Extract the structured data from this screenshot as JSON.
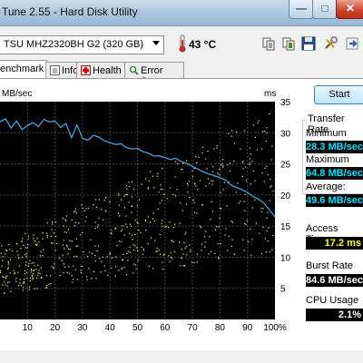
{
  "window": {
    "title": "Tune 2.55 - Hard Disk Utility"
  },
  "toolbar": {
    "drive": "TSU MHZ2320BH G2 (320 GB)",
    "temperature": "43 °C",
    "icons": [
      "copy-icon",
      "copy-all-icon",
      "save-icon",
      "options-icon",
      "exit-icon"
    ]
  },
  "tabs": [
    {
      "label": "enchmark",
      "active": true
    },
    {
      "label": "Info"
    },
    {
      "label": "Health"
    },
    {
      "label": "Error Scan"
    }
  ],
  "start_label": "Start",
  "stats": {
    "transfer_rate_title": "Transfer Rate",
    "minimum_label": "Minimum",
    "minimum_value": "28.3 MB/sec",
    "maximum_label": "Maximum",
    "maximum_value": "64.8 MB/sec",
    "average_label": "Average:",
    "average_value": "49.6 MB/sec",
    "access_time_label": "Access Time:",
    "access_time_value": "17.2 ms",
    "burst_rate_label": "Burst Rate",
    "burst_rate_value": "84.6 MB/sec",
    "cpu_usage_label": "CPU Usage",
    "cpu_usage_value": "2.1%"
  },
  "chart_data": {
    "type": "line",
    "xlabel": "",
    "ylabel_left": "MB/sec",
    "ylabel_right": "ms",
    "x_ticks": [
      "10",
      "20",
      "30",
      "40",
      "50",
      "60",
      "70",
      "80",
      "90",
      "100%"
    ],
    "y_right_ticks": [
      "35",
      "30",
      "25",
      "20",
      "15",
      "10",
      "5"
    ],
    "x_range": [
      0,
      100
    ],
    "y_right_range": [
      0,
      35
    ],
    "grid": true,
    "series": [
      {
        "color": "#4aa0d8",
        "x": [
          0,
          2,
          4,
          6,
          8,
          10,
          12,
          14,
          16,
          18,
          20,
          22,
          24,
          26,
          28,
          30,
          32,
          34,
          36,
          38,
          40,
          42,
          44,
          46,
          48,
          50,
          52,
          54,
          56,
          58,
          60,
          62,
          64,
          66,
          68,
          70,
          72,
          74,
          76,
          78,
          80,
          82,
          84,
          86,
          88,
          90,
          92,
          94,
          96,
          98,
          100
        ],
        "y": [
          63.5,
          64.5,
          61.5,
          63.8,
          61.0,
          62.4,
          63.2,
          62.0,
          64.3,
          63.5,
          63.8,
          61.7,
          63.0,
          58.4,
          62.5,
          58.2,
          57.6,
          59.2,
          58.6,
          57.4,
          56.8,
          56.2,
          56.5,
          55.2,
          54.8,
          55.0,
          53.9,
          53.4,
          52.5,
          52.6,
          52.0,
          51.4,
          51.8,
          50.7,
          50.1,
          49.2,
          48.3,
          47.4,
          46.7,
          46.2,
          45.6,
          44.8,
          43.2,
          42.4,
          41.7,
          40.8,
          39.5,
          38.7,
          37.4,
          35.2,
          33.0
        ]
      }
    ],
    "scatter": {
      "description_count": 600,
      "color": "#ffff80"
    }
  }
}
